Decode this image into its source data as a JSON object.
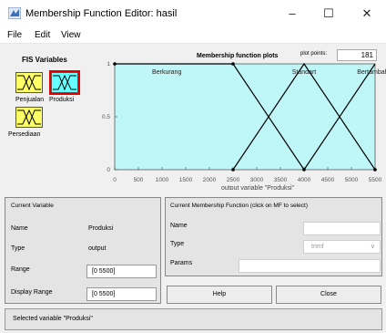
{
  "window": {
    "title": "Membership Function Editor: hasil",
    "minimize": "–",
    "maximize": "☐",
    "close": "✕",
    "icon": "matlab-icon"
  },
  "menu": {
    "file": "File",
    "edit": "Edit",
    "view": "View"
  },
  "fis": {
    "title": "FIS Variables",
    "variables": [
      "Penjualan",
      "Produksi",
      "Persediaan"
    ],
    "selected": "Produksi"
  },
  "plot": {
    "title": "Membership function plots",
    "points_label": "plot points:",
    "points_value": "181"
  },
  "chart_data": {
    "type": "line",
    "xlabel": "output variable \"Produksi\"",
    "xlim": [
      0,
      5500
    ],
    "ylim": [
      0,
      1
    ],
    "x_ticks": [
      "0",
      "500",
      "1000",
      "1500",
      "2000",
      "2500",
      "3000",
      "3500",
      "4000",
      "4500",
      "5000",
      "5500"
    ],
    "y_ticks": [
      "0",
      "0.5",
      "1"
    ],
    "series": [
      {
        "name": "Berkurang",
        "x": [
          0,
          2500,
          4000
        ],
        "y": [
          1,
          1,
          0
        ]
      },
      {
        "name": "Standart",
        "x": [
          2500,
          4000,
          5500
        ],
        "y": [
          0,
          1,
          0
        ]
      },
      {
        "name": "Bertambah",
        "x": [
          4000,
          5500,
          5500
        ],
        "y": [
          0,
          1,
          1
        ]
      }
    ],
    "background": "#bff6f8",
    "line_color": "#000000"
  },
  "current_variable": {
    "header": "Current Variable",
    "name_label": "Name",
    "name_value": "Produksi",
    "type_label": "Type",
    "type_value": "output",
    "range_label": "Range",
    "range_value": "[0 5500]",
    "display_range_label": "Display Range",
    "display_range_value": "[0 5500]"
  },
  "current_mf": {
    "header": "Current Membership Function (click on MF to select)",
    "name_label": "Name",
    "name_value": "",
    "type_label": "Type",
    "type_value": "trimf",
    "params_label": "Params",
    "params_value": ""
  },
  "buttons": {
    "help": "Help",
    "close": "Close"
  },
  "status": "Selected variable \"Produksi\""
}
